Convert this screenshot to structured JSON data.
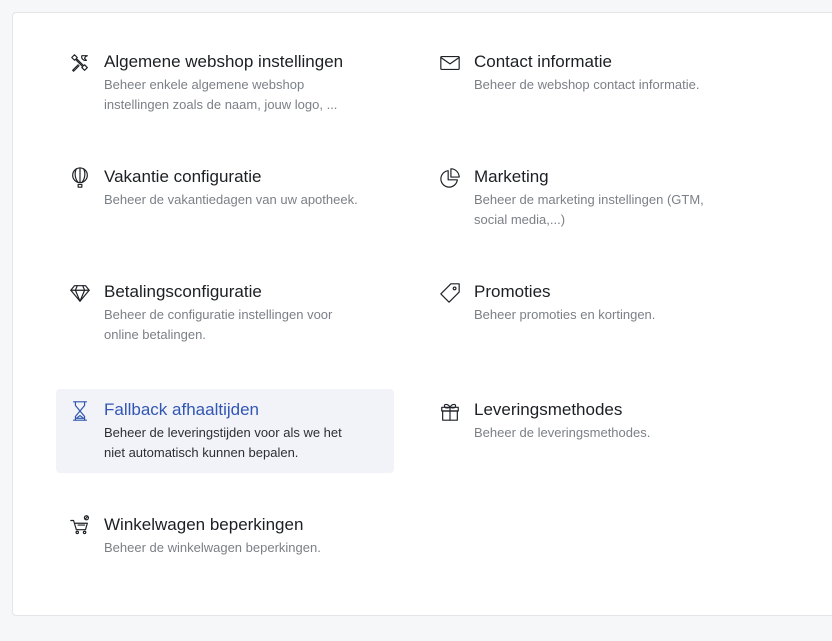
{
  "settings": {
    "items": [
      {
        "icon": "tools-icon",
        "title": "Algemene webshop instellingen",
        "desc_line1": "Beheer enkele algemene webshop",
        "desc_line2": "instellingen zoals de naam, jouw logo, ..."
      },
      {
        "icon": "envelope-icon",
        "title": "Contact informatie",
        "desc_line1": "Beheer de webshop contact informatie.",
        "desc_line2": ""
      },
      {
        "icon": "balloon-icon",
        "title": "Vakantie configuratie",
        "desc_line1": "Beheer de vakantiedagen van uw apotheek.",
        "desc_line2": ""
      },
      {
        "icon": "pie-chart-icon",
        "title": "Marketing",
        "desc_line1": "Beheer de marketing instellingen (GTM,",
        "desc_line2": "social media,...)"
      },
      {
        "icon": "diamond-icon",
        "title": "Betalingsconfiguratie",
        "desc_line1": "Beheer de configuratie instellingen voor",
        "desc_line2": "online betalingen."
      },
      {
        "icon": "tag-icon",
        "title": "Promoties",
        "desc_line1": "Beheer promoties en kortingen.",
        "desc_line2": ""
      },
      {
        "icon": "hourglass-icon",
        "title": "Fallback afhaaltijden",
        "desc_line1": "Beheer de leveringstijden voor als we het",
        "desc_line2": "niet automatisch kunnen bepalen."
      },
      {
        "icon": "gift-icon",
        "title": "Leveringsmethodes",
        "desc_line1": "Beheer de leveringsmethodes.",
        "desc_line2": ""
      },
      {
        "icon": "cart-blocked-icon",
        "title": "Winkelwagen beperkingen",
        "desc_line1": "Beheer de winkelwagen beperkingen.",
        "desc_line2": ""
      }
    ]
  },
  "colors": {
    "active_text": "#3156b3",
    "active_bg": "#f2f3f8",
    "title": "#1c1f23",
    "desc": "#7b8087"
  }
}
